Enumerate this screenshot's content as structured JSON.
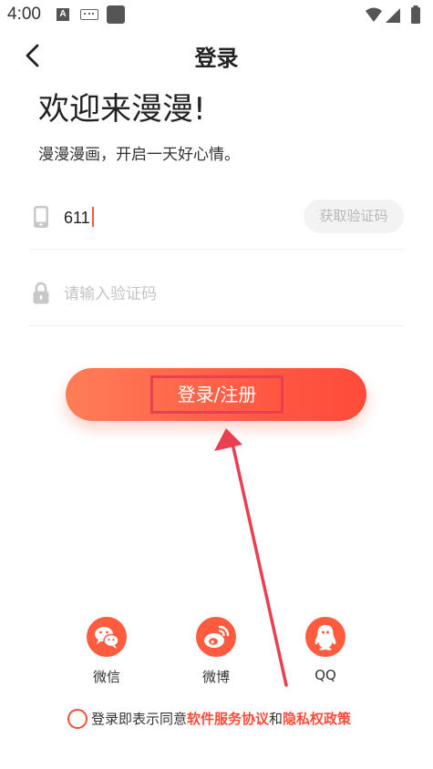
{
  "status_bar": {
    "time": "4:00",
    "a_badge": "A"
  },
  "nav": {
    "title": "登录"
  },
  "welcome": {
    "title": "欢迎来漫漫!",
    "subtitle": "漫漫漫画，开启一天好心情。"
  },
  "phone_field": {
    "value": "611",
    "get_code_label": "获取验证码",
    "icon": "phone-icon"
  },
  "code_field": {
    "placeholder": "请输入验证码",
    "icon": "lock-icon"
  },
  "login_button": {
    "label": "登录/注册"
  },
  "social": {
    "items": [
      {
        "label": "微信",
        "icon": "wechat-icon"
      },
      {
        "label": "微博",
        "icon": "weibo-icon"
      },
      {
        "label": "QQ",
        "icon": "qq-icon"
      }
    ]
  },
  "agreement": {
    "prefix": "登录即表示同意",
    "terms_link": "软件服务协议",
    "and": "和",
    "privacy_link": "隐私权政策"
  },
  "colors": {
    "accent": "#ff4b3a",
    "button_gradient_start": "#ff7d57",
    "button_gradient_end": "#ff4a3a",
    "annotation": "#e8404f"
  }
}
